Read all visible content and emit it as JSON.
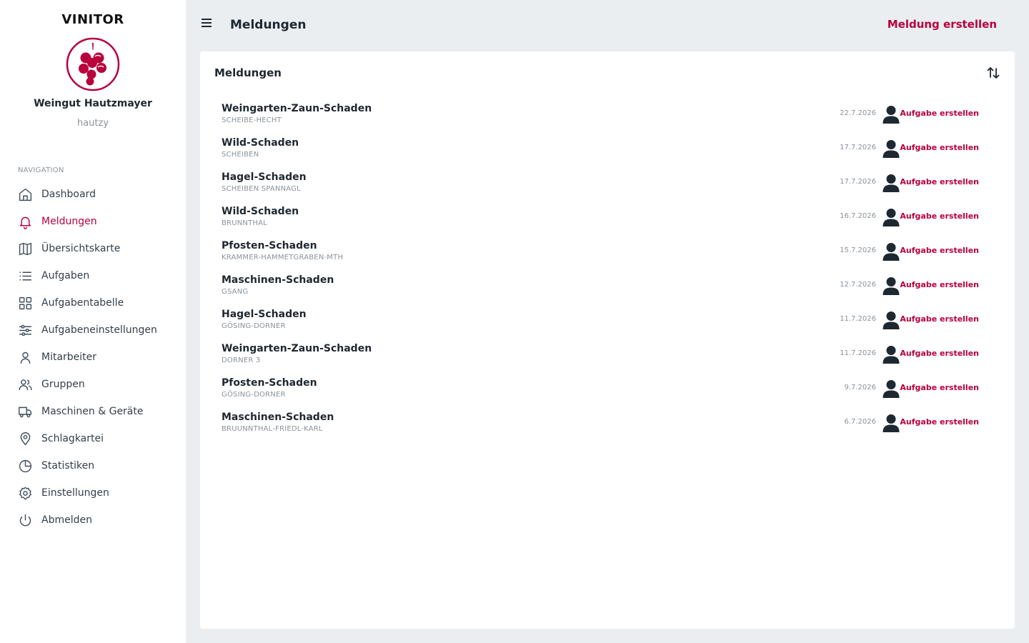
{
  "brand": "VINITOR",
  "company": "Weingut Hautzmayer",
  "username": "hautzy",
  "nav_heading": "NAVIGATION",
  "nav": [
    {
      "label": "Dashboard",
      "icon": "home-icon",
      "active": false
    },
    {
      "label": "Meldungen",
      "icon": "bell-icon",
      "active": true
    },
    {
      "label": "Übersichtskarte",
      "icon": "map-icon",
      "active": false
    },
    {
      "label": "Aufgaben",
      "icon": "list-icon",
      "active": false
    },
    {
      "label": "Aufgabentabelle",
      "icon": "grid-icon",
      "active": false
    },
    {
      "label": "Aufgabeneinstellungen",
      "icon": "sliders-icon",
      "active": false
    },
    {
      "label": "Mitarbeiter",
      "icon": "user-icon",
      "active": false
    },
    {
      "label": "Gruppen",
      "icon": "users-icon",
      "active": false
    },
    {
      "label": "Maschinen & Geräte",
      "icon": "truck-icon",
      "active": false
    },
    {
      "label": "Schlagkartei",
      "icon": "map-pin-icon",
      "active": false
    },
    {
      "label": "Statistiken",
      "icon": "pie-chart-icon",
      "active": false
    },
    {
      "label": "Einstellungen",
      "icon": "gear-icon",
      "active": false
    },
    {
      "label": "Abmelden",
      "icon": "power-icon",
      "active": false
    }
  ],
  "header": {
    "title": "Meldungen",
    "create_label": "Meldung erstellen"
  },
  "card": {
    "title": "Meldungen",
    "action_label": "Aufgabe erstellen",
    "rows": [
      {
        "title": "Weingarten-Zaun-Schaden",
        "sub": "SCHEIBE-HECHT",
        "date": "22.7.2026"
      },
      {
        "title": "Wild-Schaden",
        "sub": "SCHEIBEN",
        "date": "17.7.2026"
      },
      {
        "title": "Hagel-Schaden",
        "sub": "SCHEIBEN SPANNAGL",
        "date": "17.7.2026"
      },
      {
        "title": "Wild-Schaden",
        "sub": "BRUNNTHAL",
        "date": "16.7.2026"
      },
      {
        "title": "Pfosten-Schaden",
        "sub": "KRAMMER-HAMMETGRABEN-MTH",
        "date": "15.7.2026"
      },
      {
        "title": "Maschinen-Schaden",
        "sub": "GSANG",
        "date": "12.7.2026"
      },
      {
        "title": "Hagel-Schaden",
        "sub": "GÖSING-DORNER",
        "date": "11.7.2026"
      },
      {
        "title": "Weingarten-Zaun-Schaden",
        "sub": "DORNER 3",
        "date": "11.7.2026"
      },
      {
        "title": "Pfosten-Schaden",
        "sub": "GÖSING-DORNER",
        "date": "9.7.2026"
      },
      {
        "title": "Maschinen-Schaden",
        "sub": "BRUUNNTHAL-FRIEDL-KARL",
        "date": "6.7.2026"
      }
    ]
  },
  "colors": {
    "accent": "#b8003c",
    "background": "#ebeef1"
  }
}
